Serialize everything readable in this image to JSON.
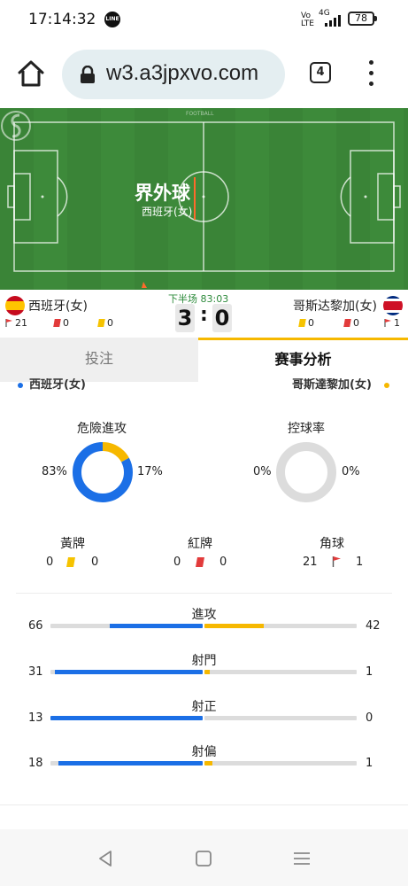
{
  "status_bar": {
    "time": "17:14:32",
    "line_label": "LINE",
    "volte": "Vo LTE",
    "network": "4G",
    "battery": "78"
  },
  "browser": {
    "url": "w3.a3jpxvo.com",
    "tab_count": "4"
  },
  "pitch": {
    "brand": "FOOTBALL",
    "event_title": "界外球",
    "event_team": "西班牙(女)",
    "colors": {
      "grass": "#3d8a3a",
      "grass_light": "#44933f",
      "accent": "#ff6a2b"
    }
  },
  "match": {
    "period": "下半场 83:03",
    "home": {
      "name": "西班牙(女)",
      "score": "3",
      "corners": "21",
      "red_cards": "0",
      "yellow_cards": "0"
    },
    "away": {
      "name": "哥斯达黎加(女)",
      "score": "0",
      "yellow_cards": "0",
      "red_cards": "0",
      "corners": "1"
    },
    "score_separator": ":"
  },
  "tabs": {
    "bet": "投注",
    "analysis": "赛事分析"
  },
  "legend": {
    "home": "西班牙(女)",
    "away": "哥斯達黎加(女)",
    "colors": {
      "home": "#1b6fe6",
      "away": "#f6b800"
    }
  },
  "donuts": {
    "dangerous_attacks": {
      "title": "危險進攻",
      "home_pct": "83%",
      "away_pct": "17%",
      "home_value": 83,
      "away_value": 17
    },
    "possession": {
      "title": "控球率",
      "home_pct": "0%",
      "away_pct": "0%",
      "home_value": 0,
      "away_value": 0
    }
  },
  "counts": {
    "yellow": {
      "title": "黃牌",
      "home": "0",
      "away": "0"
    },
    "red": {
      "title": "紅牌",
      "home": "0",
      "away": "0"
    },
    "corners": {
      "title": "角球",
      "home": "21",
      "away": "1"
    }
  },
  "bars": [
    {
      "title": "進攻",
      "home": "66",
      "away": "42",
      "home_value": 66,
      "away_value": 42
    },
    {
      "title": "射門",
      "home": "31",
      "away": "1",
      "home_value": 31,
      "away_value": 1
    },
    {
      "title": "射正",
      "home": "13",
      "away": "0",
      "home_value": 13,
      "away_value": 0
    },
    {
      "title": "射偏",
      "home": "18",
      "away": "1",
      "home_value": 18,
      "away_value": 1
    }
  ]
}
